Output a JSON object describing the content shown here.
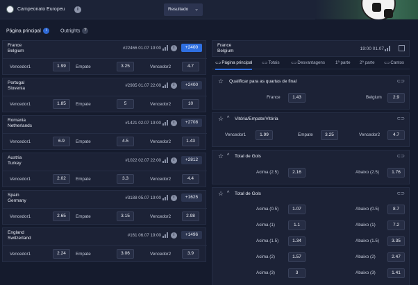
{
  "header": {
    "title": "Campeonato Europeu",
    "info_icon": "i",
    "result_button": "Resultado",
    "result_chevron": "⌄"
  },
  "subtabs": [
    {
      "label": "Página principal",
      "badge": "i"
    },
    {
      "label": "Outrights",
      "badge": "?"
    }
  ],
  "matches": [
    {
      "team1": "France",
      "team2": "Belgium",
      "id": "#22466",
      "date": "01.07",
      "time": "19:00",
      "more": "+2400",
      "active": true,
      "odds": [
        {
          "label": "Vencedor1",
          "value": "1.99"
        },
        {
          "label": "Empate",
          "value": "3.25"
        },
        {
          "label": "Vencedor2",
          "value": "4.7"
        }
      ]
    },
    {
      "team1": "Portugal",
      "team2": "Slovenia",
      "id": "#2985",
      "date": "01.07",
      "time": "22:00",
      "more": "+2400",
      "active": false,
      "odds": [
        {
          "label": "Vencedor1",
          "value": "1.85"
        },
        {
          "label": "Empate",
          "value": "5"
        },
        {
          "label": "Vencedor2",
          "value": "10"
        }
      ]
    },
    {
      "team1": "Romania",
      "team2": "Netherlands",
      "id": "#1421",
      "date": "02.07",
      "time": "19:00",
      "more": "+2708",
      "active": false,
      "odds": [
        {
          "label": "Vencedor1",
          "value": "6.9"
        },
        {
          "label": "Empate",
          "value": "4.5"
        },
        {
          "label": "Vencedor2",
          "value": "1.43"
        }
      ]
    },
    {
      "team1": "Austria",
      "team2": "Turkey",
      "id": "#1022",
      "date": "02.07",
      "time": "22:00",
      "more": "+2812",
      "active": false,
      "odds": [
        {
          "label": "Vencedor1",
          "value": "2.02"
        },
        {
          "label": "Empate",
          "value": "3.3"
        },
        {
          "label": "Vencedor2",
          "value": "4.4"
        }
      ]
    },
    {
      "team1": "Spain",
      "team2": "Germany",
      "id": "#3188",
      "date": "05.07",
      "time": "19:00",
      "more": "+1625",
      "active": false,
      "odds": [
        {
          "label": "Vencedor1",
          "value": "2.65"
        },
        {
          "label": "Empate",
          "value": "3.15"
        },
        {
          "label": "Vencedor2",
          "value": "2.98"
        }
      ]
    },
    {
      "team1": "England",
      "team2": "Switzerland",
      "id": "#161",
      "date": "06.07",
      "time": "19:00",
      "more": "+1496",
      "active": false,
      "odds": [
        {
          "label": "Vencedor1",
          "value": "2.24"
        },
        {
          "label": "Empate",
          "value": "3.06"
        },
        {
          "label": "Vencedor2",
          "value": "3.9"
        }
      ]
    }
  ],
  "detail": {
    "team1": "France",
    "team2": "Belgium",
    "date": "01.07",
    "time": "19:00",
    "tabs": [
      "Página principal",
      "Totais",
      "Desvantagens",
      "1ª parte",
      "2ª parte",
      "Cantos"
    ],
    "markets": [
      {
        "title": "Qualificar para as quartas de final",
        "star": "☆",
        "caret": "",
        "lines": [
          [
            {
              "label": "France",
              "value": "1.43"
            },
            {
              "label": "Belgium",
              "value": "2.9"
            }
          ]
        ]
      },
      {
        "title": "Vitória/Empate/Vitória",
        "star": "☆",
        "caret": "^",
        "lines": [
          [
            {
              "label": "Vencedor1",
              "value": "1.99"
            },
            {
              "label": "Empate",
              "value": "3.25"
            },
            {
              "label": "Vencedor2",
              "value": "4.7"
            }
          ]
        ]
      },
      {
        "title": "Total de Gols",
        "star": "☆",
        "caret": "^",
        "lines": [
          [
            {
              "label": "Acima (2.5)",
              "value": "2.16"
            },
            {
              "label": "Abaixo (2.5)",
              "value": "1.76"
            }
          ]
        ]
      },
      {
        "title": "Total de Gols",
        "star": "☆",
        "caret": "^",
        "lines": [
          [
            {
              "label": "Acima (0.5)",
              "value": "1.07"
            },
            {
              "label": "Abaixo (0.5)",
              "value": "8.7"
            }
          ],
          [
            {
              "label": "Acima (1)",
              "value": "1.1"
            },
            {
              "label": "Abaixo (1)",
              "value": "7.2"
            }
          ],
          [
            {
              "label": "Acima (1.5)",
              "value": "1.34"
            },
            {
              "label": "Abaixo (1.5)",
              "value": "3.35"
            }
          ],
          [
            {
              "label": "Acima (2)",
              "value": "1.57"
            },
            {
              "label": "Abaixo (2)",
              "value": "2.47"
            }
          ],
          [
            {
              "label": "Acima (3)",
              "value": "3"
            },
            {
              "label": "Abaixo (3)",
              "value": "1.41"
            }
          ]
        ]
      }
    ]
  },
  "icons": {
    "tab_link": "link-icon",
    "market_link": "link-icon",
    "stats": "bar-chart-icon",
    "expand": "expand-icon"
  }
}
